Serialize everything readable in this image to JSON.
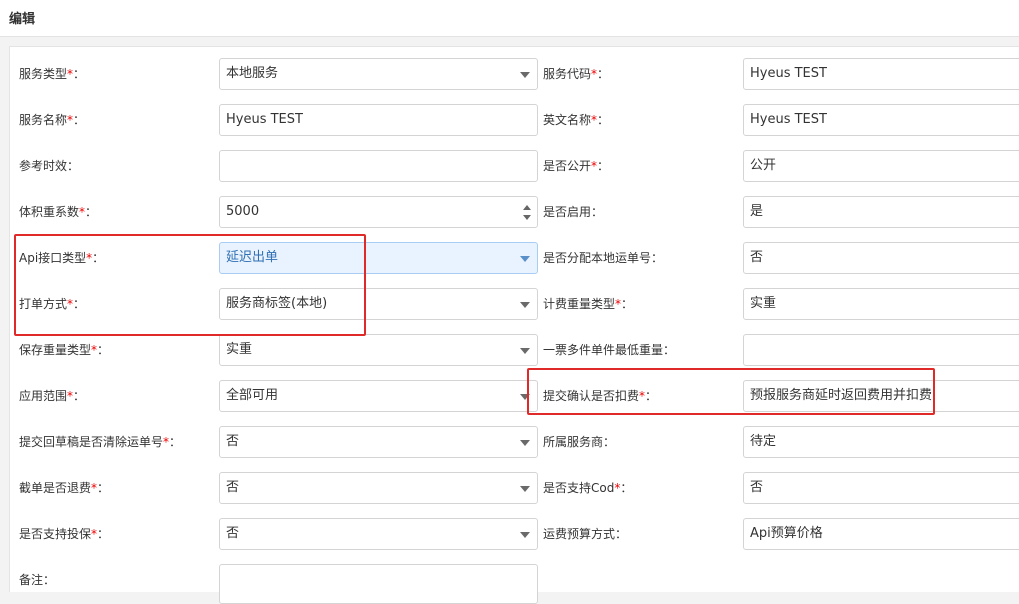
{
  "header": {
    "title": "编辑"
  },
  "required_mark": "*",
  "left_fields": [
    {
      "label": "服务类型",
      "colon": "：",
      "required": true,
      "value": "本地服务",
      "type": "select"
    },
    {
      "label": "服务名称",
      "colon": "：",
      "required": true,
      "value": "Hyeus TEST",
      "type": "text"
    },
    {
      "label": "参考时效",
      "colon": "：",
      "required": false,
      "value": "",
      "type": "text"
    },
    {
      "label": "体积重系数",
      "colon": "：",
      "required": true,
      "value": "5000",
      "type": "number"
    },
    {
      "label": "Api接口类型",
      "colon": "：",
      "required": true,
      "value": "延迟出单",
      "type": "select-active"
    },
    {
      "label": "打单方式",
      "colon": "：",
      "required": true,
      "value": "服务商标签(本地)",
      "type": "select"
    },
    {
      "label": "保存重量类型",
      "colon": "：",
      "required": true,
      "value": "实重",
      "type": "select"
    },
    {
      "label": "应用范围",
      "colon": "：",
      "required": true,
      "value": "全部可用",
      "type": "select"
    },
    {
      "label": "提交回草稿是否清除运单号",
      "colon": "：",
      "required": true,
      "value": "否",
      "type": "select"
    },
    {
      "label": "截单是否退费",
      "colon": "：",
      "required": true,
      "value": "否",
      "type": "select"
    },
    {
      "label": "是否支持投保",
      "colon": "：",
      "required": true,
      "value": "否",
      "type": "select"
    },
    {
      "label": "备注",
      "colon": "：",
      "required": false,
      "value": "",
      "type": "textarea"
    }
  ],
  "right_fields": [
    {
      "label": "服务代码",
      "colon": "：",
      "required": true,
      "value": "Hyeus TEST"
    },
    {
      "label": "英文名称",
      "colon": "：",
      "required": true,
      "value": "Hyeus TEST"
    },
    {
      "label": "是否公开",
      "colon": "：",
      "required": true,
      "value": "公开"
    },
    {
      "label": "是否启用",
      "colon": "：",
      "required": false,
      "value": "是"
    },
    {
      "label": "是否分配本地运单号",
      "colon": "：",
      "required": false,
      "value": "否"
    },
    {
      "label": "计费重量类型",
      "colon": "：",
      "required": true,
      "value": "实重"
    },
    {
      "label": "一票多件单件最低重量",
      "colon": "：",
      "required": false,
      "value": ""
    },
    {
      "label": "提交确认是否扣费",
      "colon": "：",
      "required": true,
      "value": "预报服务商延时返回费用并扣费"
    },
    {
      "label": "所属服务商",
      "colon": "：",
      "required": false,
      "value": "待定"
    },
    {
      "label": "是否支持Cod",
      "colon": "：",
      "required": true,
      "value": "否"
    },
    {
      "label": "运费预算方式",
      "colon": "：",
      "required": false,
      "value": "Api预算价格"
    }
  ],
  "highlight_color": "#e02a2a"
}
